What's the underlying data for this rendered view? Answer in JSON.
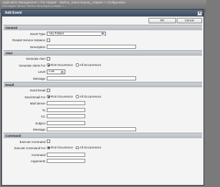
{
  "background": {
    "breadcrumb": "Application Management > For Adapter - BaFlex_Intercompany_Adapter > Configuration",
    "subline": "Edit Adapter Service: BaFlex Intercompany Adapter > ..."
  },
  "dialog": {
    "title": "Add Event",
    "ok_label": "OK",
    "cancel_label": "Cancel",
    "close_glyph": "x"
  },
  "general": {
    "heading": "General",
    "event_type_label": "Event Type",
    "event_type_value": "Any Failure",
    "restart_label": "Restart Service Instance",
    "description_label": "Description",
    "description_value": ""
  },
  "alert": {
    "heading": "Alert",
    "generate_label": "Generate Alert",
    "generate_for_label": "Generate Alerts For",
    "opt_first": "First Occurrence",
    "opt_all": "All Occurrences",
    "level_label": "Level",
    "level_value": "Low",
    "message_label": "Message",
    "message_value": ""
  },
  "email": {
    "heading": "Email",
    "send_label": "Send Email",
    "send_for_label": "Send Email For",
    "opt_first": "First Occurrence",
    "opt_all": "All Occurrences",
    "server_label": "Mail Server",
    "to_label": "To",
    "cc_label": "CC",
    "subject_label": "Subject",
    "message_label": "Message"
  },
  "command": {
    "heading": "Command",
    "execute_label": "Execute Command",
    "execute_for_label": "Execute Command For",
    "opt_first": "First Occurrence",
    "opt_all": "All Occurrences",
    "command_label": "Command",
    "arguments_label": "Arguments"
  }
}
